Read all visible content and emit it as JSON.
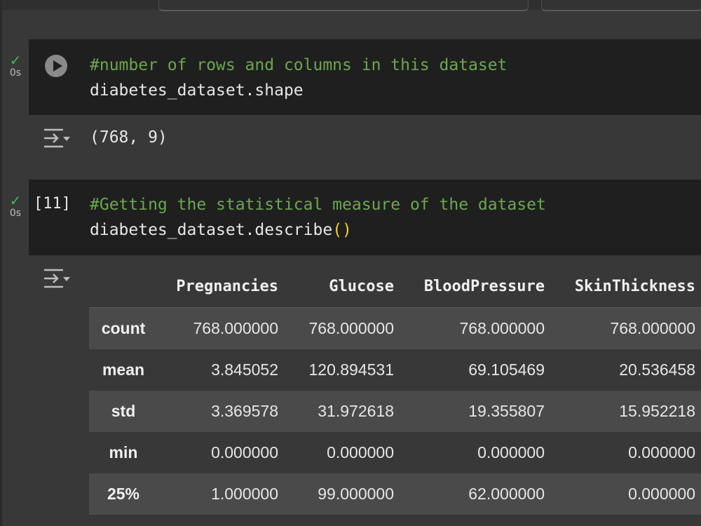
{
  "cells": [
    {
      "status_check": "✓",
      "status_time": "0s",
      "execution_count": "",
      "code_comment": "#number of rows and columns in this dataset",
      "code_line2": "diabetes_dataset.shape",
      "output": "(768, 9)"
    },
    {
      "status_check": "✓",
      "status_time": "0s",
      "execution_count": "[11]",
      "code_comment": "#Getting the statistical measure of the dataset",
      "code_line2_prefix": "diabetes_dataset.describe",
      "code_line2_parens": "()"
    }
  ],
  "dataframe": {
    "columns": [
      "Pregnancies",
      "Glucose",
      "BloodPressure",
      "SkinThickness"
    ],
    "rows": [
      {
        "index": "count",
        "values": [
          "768.000000",
          "768.000000",
          "768.000000",
          "768.000000"
        ]
      },
      {
        "index": "mean",
        "values": [
          "3.845052",
          "120.894531",
          "69.105469",
          "20.536458"
        ]
      },
      {
        "index": "std",
        "values": [
          "3.369578",
          "31.972618",
          "19.355807",
          "15.952218"
        ]
      },
      {
        "index": "min",
        "values": [
          "0.000000",
          "0.000000",
          "0.000000",
          "0.000000"
        ]
      },
      {
        "index": "25%",
        "values": [
          "1.000000",
          "99.000000",
          "62.000000",
          "0.000000"
        ]
      }
    ]
  },
  "colors": {
    "background": "#383838",
    "code_cell": "#1f1f1f",
    "comment": "#6aa84f",
    "paren": "#f1d02d",
    "success": "#3fb950"
  },
  "icons": {
    "run": "play-circle-icon",
    "output_toggle": "output-menu-icon",
    "status": "check-icon"
  }
}
